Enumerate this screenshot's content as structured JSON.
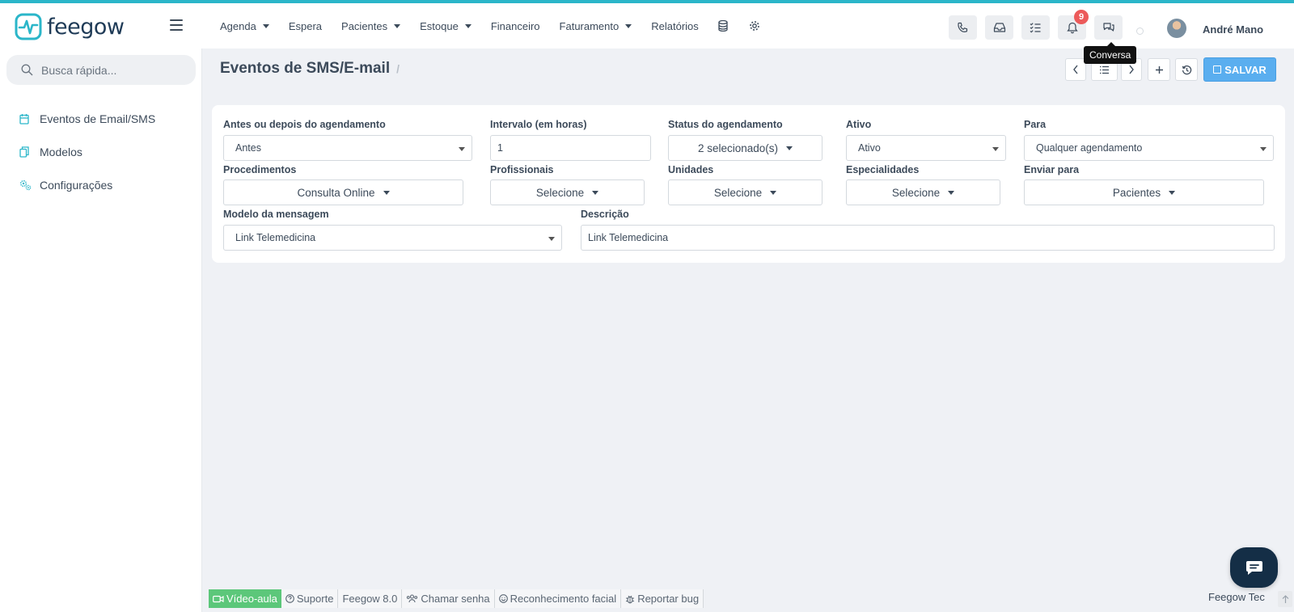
{
  "app": {
    "name": "feegow"
  },
  "topnav": {
    "items": [
      {
        "label": "Agenda",
        "dropdown": true
      },
      {
        "label": "Espera",
        "dropdown": false
      },
      {
        "label": "Pacientes",
        "dropdown": true
      },
      {
        "label": "Estoque",
        "dropdown": true
      },
      {
        "label": "Financeiro",
        "dropdown": false
      },
      {
        "label": "Faturamento",
        "dropdown": true
      },
      {
        "label": "Relatórios",
        "dropdown": false
      }
    ],
    "notification_count": "9",
    "tooltip": "Conversa",
    "user_name": "André Mano"
  },
  "sidebar": {
    "search_placeholder": "Busca rápida...",
    "items": [
      {
        "label": "Eventos de Email/SMS",
        "icon": "calendar-icon"
      },
      {
        "label": "Modelos",
        "icon": "copy-icon"
      },
      {
        "label": "Configurações",
        "icon": "cogs-icon"
      }
    ]
  },
  "page": {
    "title": "Eventos de SMS/E-mail",
    "breadcrumb_sep": "/",
    "save_label": "SALVAR"
  },
  "form": {
    "antes_depois": {
      "label": "Antes ou depois do agendamento",
      "value": "Antes"
    },
    "intervalo": {
      "label": "Intervalo (em horas)",
      "value": "1"
    },
    "status": {
      "label": "Status do agendamento",
      "value": "2 selecionado(s)"
    },
    "ativo": {
      "label": "Ativo",
      "value": "Ativo"
    },
    "para": {
      "label": "Para",
      "value": "Qualquer agendamento"
    },
    "procedimentos": {
      "label": "Procedimentos",
      "value": "Consulta Online"
    },
    "profissionais": {
      "label": "Profissionais",
      "value": "Selecione"
    },
    "unidades": {
      "label": "Unidades",
      "value": "Selecione"
    },
    "especialidades": {
      "label": "Especialidades",
      "value": "Selecione"
    },
    "enviar_para": {
      "label": "Enviar para",
      "value": "Pacientes"
    },
    "modelo": {
      "label": "Modelo da mensagem",
      "value": "Link Telemedicina"
    },
    "descricao": {
      "label": "Descrição",
      "value": "Link Telemedicina"
    }
  },
  "footer": {
    "items": [
      "Vídeo-aula",
      "Suporte",
      "Feegow 8.0",
      "Chamar senha",
      "Reconhecimento facial",
      "Reportar bug"
    ],
    "right_label": "Feegow Tec"
  },
  "colors": {
    "accent": "#2bb6c9",
    "save": "#5aaeef",
    "badge": "#ec5a5a",
    "video": "#5cc77a",
    "chat": "#142e46"
  }
}
